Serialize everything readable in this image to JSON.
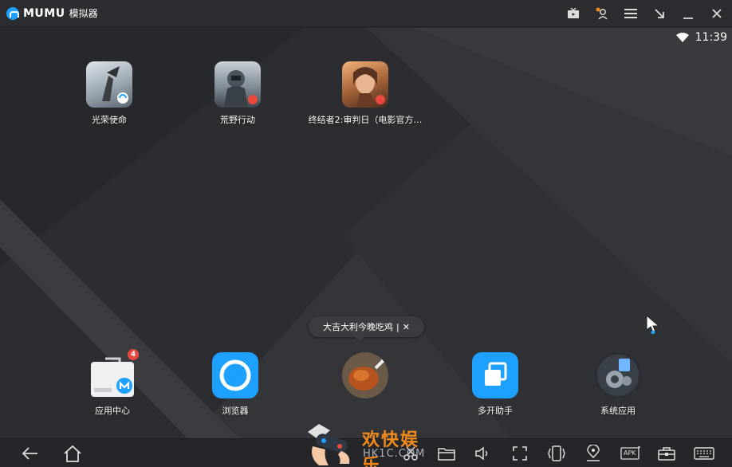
{
  "titlebar": {
    "brand": "MUMU",
    "brand_sub": "模拟器",
    "icons": [
      "tv-icon",
      "user-key-icon",
      "menu-icon",
      "minimize-to-corner-icon",
      "minimize-icon",
      "close-icon"
    ]
  },
  "status": {
    "time": "11:39",
    "wifi": "wifi-icon"
  },
  "apps": [
    {
      "label": "光荣使命"
    },
    {
      "label": "荒野行动"
    },
    {
      "label": "终结者2:审判日（电影官方…"
    }
  ],
  "dock": [
    {
      "label": "应用中心",
      "badge": "4"
    },
    {
      "label": "浏览器"
    },
    {
      "label": ""
    },
    {
      "label": "多开助手"
    },
    {
      "label": "系统应用"
    }
  ],
  "bubble": {
    "text": "大吉大利今晚吃鸡",
    "sep": "|",
    "close": "✕"
  },
  "navbar": {
    "items": [
      "back-icon",
      "home-icon",
      "scissors-icon",
      "folder-icon",
      "volume-icon",
      "fullscreen-icon",
      "shake-icon",
      "location-icon",
      "apk-install-icon",
      "toolbox-icon",
      "keyboard-icon"
    ],
    "apk_label": "APK"
  },
  "watermark": {
    "title": "欢快娱乐",
    "url": "HK1C.COM"
  },
  "colors": {
    "accent": "#1ea0ff",
    "badge": "#e9483e",
    "watermark": "#f08a1d"
  }
}
